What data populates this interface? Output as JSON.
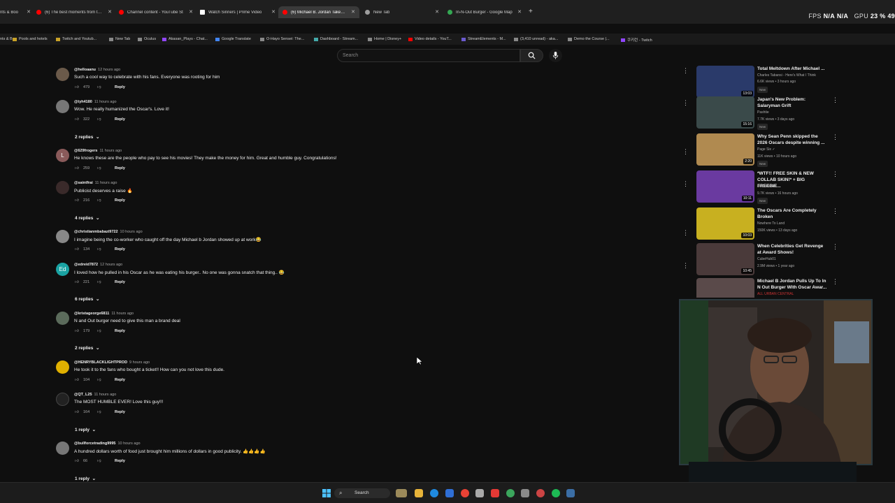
{
  "browser": {
    "tabs": [
      {
        "label": "nts & Boo",
        "color": "#4285f4"
      },
      {
        "label": "(6) The best moments from the",
        "color": "#ff0000"
      },
      {
        "label": "Channel content - YouTube St",
        "color": "#ff0000"
      },
      {
        "label": "Watch Sinners | Prime Video",
        "color": "#ffffff"
      },
      {
        "label": "(6) Michael B. Jordan Takes Hi",
        "color": "#ff0000"
      },
      {
        "label": "New Tab",
        "color": "#9e9e9e"
      },
      {
        "label": "In-N-Out Burger - Google Map",
        "color": "#34a853"
      }
    ],
    "new_tab_symbol": "+",
    "overlay": {
      "fps_label": "FPS",
      "fps_value1": "N/A",
      "fps_value2": "N/A",
      "gpu_label": "GPU",
      "gpu_value": "23 %",
      "gpu_extra": "49"
    },
    "bookmarks": [
      "Pools and hotels",
      "Twitch and Youtub...",
      "New Tab",
      "Oculus",
      "Akasan_Plays - Chat...",
      "Google Translate",
      "O-Hayo Sensei: The...",
      "Dashboard - Stream...",
      "Home | Disney+",
      "Video details - YouT...",
      "StreamElements - M...",
      "(3,410 unread) - aka...",
      "Demo the Course |...",
      "쿠키런 - Twitch"
    ]
  },
  "youtube": {
    "search_placeholder": "Search",
    "comments": [
      {
        "user": "@helloaanu",
        "time": "12 hours ago",
        "text": "Such a cool way to celebrate with his fans. Everyone was rooting for him",
        "likes": "479",
        "reply": "Reply",
        "avatar_color": "#6b5a4a",
        "avatar_letter": "",
        "replies": ""
      },
      {
        "user": "@tyh4180",
        "time": "11 hours ago",
        "text": "Wow. He really humanized the Oscar's. Love it!",
        "likes": "322",
        "reply": "Reply",
        "avatar_color": "#777777",
        "avatar_letter": "",
        "replies": "2 replies"
      },
      {
        "user": "@629frogers",
        "time": "11 hours ago",
        "text": "He knows these are the people who pay to see his movies!  They make the money for him.  Great and humble guy.  Congratulations!",
        "likes": "259",
        "reply": "Reply",
        "avatar_color": "#8a5a5a",
        "avatar_letter": "L",
        "replies": ""
      },
      {
        "user": "@saintfrai",
        "time": "11 hours ago",
        "text": "Publicist deserves a raise 🔥",
        "likes": "216",
        "reply": "Reply",
        "avatar_color": "#3a2a2a",
        "avatar_letter": "",
        "replies": "4 replies"
      },
      {
        "user": "@christianmbabazi9722",
        "time": "10 hours ago",
        "text": "I imagine being the co-worker who caught off the day Michael b Jordan showed up at work😂",
        "likes": "134",
        "reply": "Reply",
        "avatar_color": "#888888",
        "avatar_letter": "",
        "replies": ""
      },
      {
        "user": "@edreid7872",
        "time": "12 hours ago",
        "text": "I loved how he pulled in his Oscar as he was eating his burger.. No one was gonna snatch that thing.. 😂",
        "likes": "221",
        "reply": "Reply",
        "avatar_color": "#1aa3a3",
        "avatar_letter": "Ed",
        "replies": "6 replies"
      },
      {
        "user": "@kristageorge6811",
        "time": "11 hours ago",
        "text": "N and Out burger need to give this man a brand deal",
        "likes": "179",
        "reply": "Reply",
        "avatar_color": "#5b6b5b",
        "avatar_letter": "",
        "replies": "2 replies"
      },
      {
        "user": "@HENRYBLACKLIGHTPROD",
        "time": "9 hours ago",
        "text": "He took it to the fans who bought a ticket!! How can you not love this dude.",
        "likes": "104",
        "reply": "Reply",
        "avatar_color": "#e0b000",
        "avatar_letter": "",
        "replies": ""
      },
      {
        "user": "@QT_L25",
        "time": "11 hours ago",
        "text": "The MOST HUMBLE EVER! Love this guy!!!",
        "likes": "164",
        "reply": "Reply",
        "avatar_color": "#222222",
        "avatar_letter": "",
        "replies": "1 reply"
      },
      {
        "user": "@bullforcetrading9995",
        "time": "10 hours ago",
        "text": "A hundred dollars worth of food just brought him millions of dollars in good publicity. 👍👍👍👍",
        "likes": "66",
        "reply": "Reply",
        "avatar_color": "#777777",
        "avatar_letter": "",
        "replies": "1 reply"
      }
    ],
    "videos": [
      {
        "title": "Total Meltdown After Michael ...",
        "channel": "Charles Tabansi - Here's What I Think",
        "stats": "6.6K views • 3 hours ago",
        "badge": "New",
        "duration": "13:03",
        "thumb_color": "#2a3a6a"
      },
      {
        "title": "Japan's New Problem: Salaryman Grift",
        "channel": "Pashtie",
        "stats": "7.7K views • 3 days ago",
        "badge": "New",
        "duration": "15:16",
        "thumb_color": "#3a4a4a"
      },
      {
        "title": "Why Sean Penn skipped the 2026 Oscars despite winning ...",
        "channel": "Page Six ✓",
        "stats": "11K views • 10 hours ago",
        "badge": "New",
        "duration": "2:20",
        "thumb_color": "#b08a50"
      },
      {
        "title": "*WTF!! FREE SKIN & NEW COLLAB SKIN!* + BIG FREEBIE...",
        "channel": "SoDoGacha",
        "stats": "9.7K views • 16 hours ago",
        "badge": "New",
        "duration": "10:11",
        "thumb_color": "#6a3aa0"
      },
      {
        "title": "The Oscars Are Completely Broken",
        "channel": "Nowhere To Land",
        "stats": "150K views • 13 days ago",
        "badge": "",
        "duration": "10:03",
        "thumb_color": "#c8b020"
      },
      {
        "title": "When Celebrities Get Revenge at Award Shows!",
        "channel": "CubeHub01",
        "stats": "2.9M views • 1 year ago",
        "badge": "",
        "duration": "10:45",
        "thumb_color": "#4a3a3a"
      },
      {
        "title": "Michael B Jordan Pulls Up To In N Out Burger With Oscar Awar...",
        "channel": "ALL URBAN CENTRAL",
        "stats": "",
        "badge": "",
        "duration": "",
        "thumb_color": "#5a4a4a"
      }
    ]
  },
  "taskbar": {
    "search_label": "Search"
  }
}
